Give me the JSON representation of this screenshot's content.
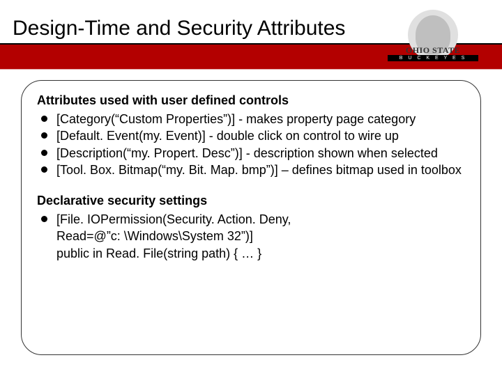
{
  "title": "Design-Time and Security Attributes",
  "logo": {
    "line1": "OHIO STATE",
    "line2": "B U C K E Y E S"
  },
  "section1": {
    "heading": "Attributes used with user defined controls",
    "items": [
      "[Category(“Custom Properties”)] - makes property page category",
      "[Default. Event(my. Event)]             - double click on control to wire up",
      "[Description(“my. Propert. Desc”)]  - description shown when selected",
      "[Tool. Box. Bitmap(“my. Bit. Map. bmp”)]  – defines bitmap used in toolbox"
    ]
  },
  "section2": {
    "heading": "Declarative security settings",
    "item": "[File. IOPermission(Security. Action. Deny,",
    "cont1": "Read=@”c: \\Windows\\System 32”)]",
    "cont2": "public in Read. File(string path) { … }"
  }
}
